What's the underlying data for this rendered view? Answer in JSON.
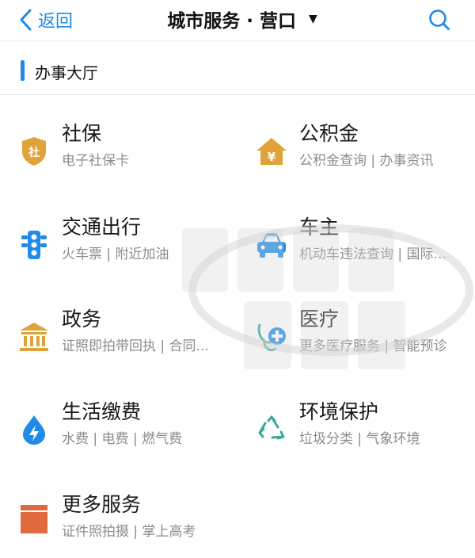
{
  "nav": {
    "back_label": "返回",
    "title": "城市服务 · 营口",
    "title_arrow": "▼",
    "back_icon": "chevron-left-icon",
    "search_icon": "search-icon"
  },
  "section": {
    "title": "办事大厅"
  },
  "services": [
    {
      "name": "社保",
      "sub": "电子社保卡",
      "icon": "social-security-shield-icon",
      "icon_glyph": "社"
    },
    {
      "name": "公积金",
      "sub": "公积金查询 | 办事资讯",
      "icon": "housing-fund-house-icon",
      "icon_glyph": "¥"
    },
    {
      "name": "交通出行",
      "sub": "火车票 | 附近加油",
      "icon": "traffic-light-icon"
    },
    {
      "name": "车主",
      "sub": "机动车违法查询 | 国际...",
      "icon": "car-icon"
    },
    {
      "name": "政务",
      "sub": "证照即拍带回执 | 合同...",
      "icon": "government-building-icon"
    },
    {
      "name": "医疗",
      "sub": "更多医疗服务 | 智能预诊",
      "icon": "stethoscope-icon"
    },
    {
      "name": "生活缴费",
      "sub": "水费 | 电费 | 燃气费",
      "icon": "utility-bolt-drop-icon"
    },
    {
      "name": "环境保护",
      "sub": "垃圾分类 | 气象环境",
      "icon": "recycle-icon"
    },
    {
      "name": "更多服务",
      "sub": "证件照拍摄 | 掌上高考",
      "icon": "more-services-box-icon"
    }
  ],
  "colors": {
    "accent": "#1f8ae8",
    "gold": "#e0a33a",
    "blue": "#1f8ae8",
    "teal": "#3aa89a",
    "orange": "#e06a3e"
  }
}
